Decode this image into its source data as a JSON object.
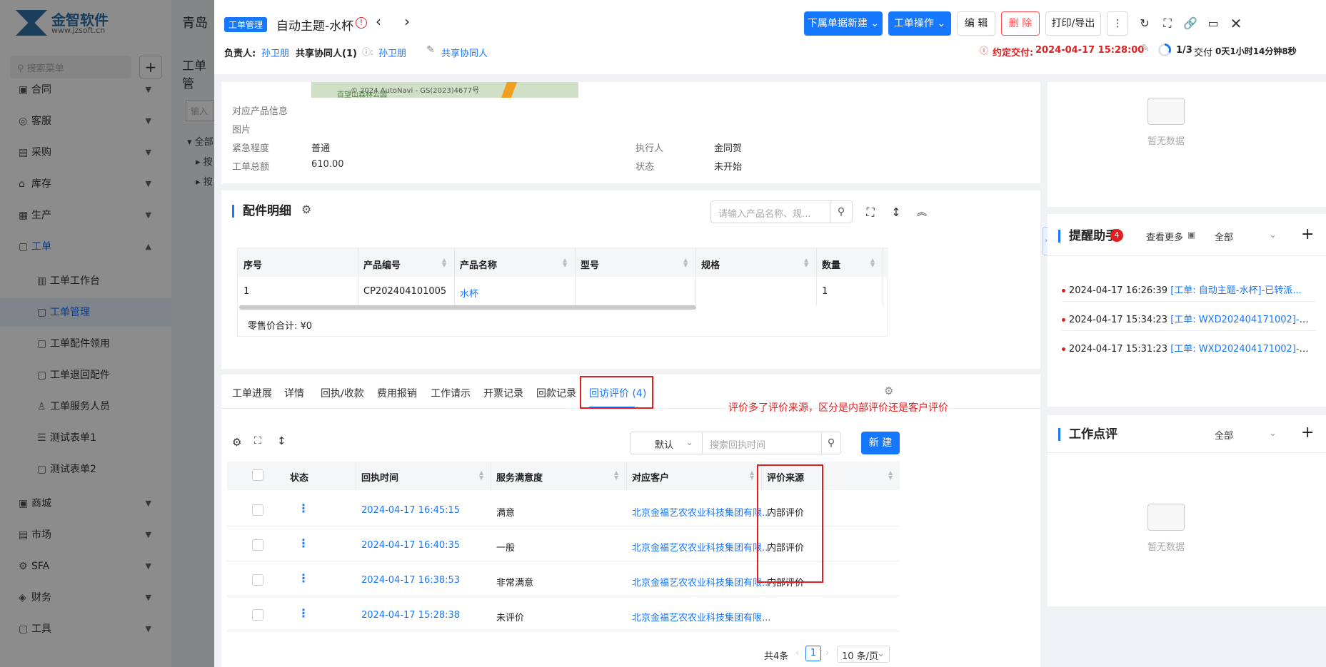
{
  "bg": {
    "logo_text": "金智软件",
    "logo_url": "www.jzsoft.cn",
    "search_placeholder": "搜索菜单",
    "menu": [
      {
        "label": "合同",
        "icon": "contract-icon"
      },
      {
        "label": "客服",
        "icon": "headset-icon"
      },
      {
        "label": "采购",
        "icon": "bag-icon"
      },
      {
        "label": "库存",
        "icon": "warehouse-icon"
      },
      {
        "label": "生产",
        "icon": "factory-icon"
      },
      {
        "label": "工单",
        "icon": "document-icon"
      }
    ],
    "submenu": [
      "工单工作台",
      "工单管理",
      "工单配件领用",
      "工单退回配件",
      "工单服务人员",
      "测试表单1",
      "测试表单2"
    ],
    "menu2": [
      {
        "label": "商城",
        "icon": "shop-icon"
      },
      {
        "label": "市场",
        "icon": "calendar-icon"
      },
      {
        "label": "SFA",
        "icon": "gear-icon"
      },
      {
        "label": "财务",
        "icon": "finance-icon"
      },
      {
        "label": "工具",
        "icon": "tool-icon"
      }
    ],
    "mid_title": "青岛",
    "mid_sub": "工单管",
    "mid_input": "输入",
    "tree": [
      "全部",
      "按",
      "按"
    ]
  },
  "header": {
    "tag": "工单管理",
    "title": "自动主题-水杯",
    "owner_label": "负责人:",
    "owner": "孙卫朋",
    "share_label": "共享协同人(1)",
    "share_name": "孙卫朋",
    "share_link": "共享协同人",
    "btn_sub_new": "下属单据新建",
    "btn_ops": "工单操作",
    "btn_edit": "编 辑",
    "btn_delete": "删 除",
    "btn_print": "打印/导出",
    "due_label": "约定交付:",
    "due_time": "2024-04-17 15:28:00",
    "progress": "1/3",
    "progress_fraction": 0.333,
    "progress_label": "交付",
    "remaining": "0天1小时14分钟8秒"
  },
  "info": {
    "map_credit": "© 2024 AutoNavi - GS(2023)4677号",
    "map_place": "百望山森林公园",
    "product_info_label": "对应产品信息",
    "image_label": "图片",
    "urgency_label": "紧急程度",
    "urgency": "普通",
    "executor_label": "执行人",
    "executor": "金同贺",
    "total_label": "工单总额",
    "total": "610.00",
    "status_label": "状态",
    "status": "未开始"
  },
  "parts": {
    "title": "配件明细",
    "search_placeholder": "请输入产品名称、规...",
    "columns": [
      "序号",
      "产品编号",
      "产品名称",
      "型号",
      "规格",
      "数量"
    ],
    "rows": [
      [
        "1",
        "CP202404101005",
        "水杯",
        "",
        "",
        "1"
      ]
    ],
    "summary": "零售价合计: ¥0"
  },
  "tabs": {
    "items": [
      "工单进展",
      "详情",
      "回执/收款",
      "费用报销",
      "工作请示",
      "开票记录",
      "回款记录",
      "回访评价 (4)"
    ],
    "active": 7
  },
  "annotation": "评价多了评价来源，区分是内部评价还是客户评价",
  "review": {
    "filter": "默认",
    "search_placeholder": "搜索回执时间",
    "new_btn": "新 建",
    "columns": [
      "状态",
      "回执时间",
      "服务满意度",
      "对应客户",
      "评价来源"
    ],
    "rows": [
      {
        "time": "2024-04-17 16:45:15",
        "satisfaction": "满意",
        "customer": "北京金福艺农农业科技集团有限...",
        "source": "内部评价"
      },
      {
        "time": "2024-04-17 16:40:35",
        "satisfaction": "一般",
        "customer": "北京金福艺农农业科技集团有限...",
        "source": "内部评价"
      },
      {
        "time": "2024-04-17 16:38:53",
        "satisfaction": "非常满意",
        "customer": "北京金福艺农农业科技集团有限...",
        "source": "内部评价"
      },
      {
        "time": "2024-04-17 15:28:38",
        "satisfaction": "未评价",
        "customer": "北京金福艺农农业科技集团有限...",
        "source": ""
      }
    ],
    "total": "共4条",
    "page": "1",
    "page_size": "10 条/页"
  },
  "right": {
    "empty_text": "暂无数据",
    "reminder_title": "提醒助手",
    "reminder_count": "4",
    "see_more": "查看更多",
    "filter_all": "全部",
    "notices": [
      {
        "time": "2024-04-17 16:26:39",
        "text": "[工单: 自动主题-水杯]-已转派..."
      },
      {
        "time": "2024-04-17 15:34:23",
        "text": "[工单: WXD202404171002]-已..."
      },
      {
        "time": "2024-04-17 15:31:23",
        "text": "[工单: WXD202404171002]-已..."
      }
    ],
    "comment_title": "工作点评",
    "comment_filter": "全部",
    "empty_text2": "暂无数据"
  }
}
